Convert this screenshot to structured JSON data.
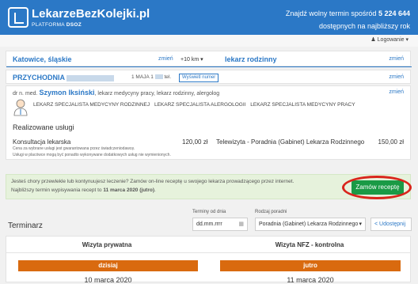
{
  "header": {
    "logo_title": "LekarzeBezKolejki.pl",
    "logo_sub_prefix": "PLATFORMA ",
    "logo_sub_brand": "DSOZ",
    "slogan_prefix": "Znajdź wolny termin spośród ",
    "slogan_count": "5 224 644",
    "slogan_line2": "dostępnych na najbliższy rok",
    "login_label": "Logowanie"
  },
  "search": {
    "location": "Katowice, śląskie",
    "location_change": "zmień",
    "radius": "+10 km",
    "specialty": "lekarz rodzinny",
    "specialty_change": "zmień"
  },
  "clinic": {
    "name": "PRZYCHODNIA",
    "address": "1 MAJA 1",
    "phone_label": "tel.",
    "phone_button": "Wyświetl numer",
    "change": "zmień"
  },
  "doctor": {
    "title": "dr n. med.",
    "name": "Szymon Iksiński",
    "desc": "lekarz medycyny pracy, lekarz rodzinny, alergolog",
    "change": "zmień",
    "specialties": [
      "LEKARZ SPECJALISTA MEDYCYNY RODZINNEJ",
      "LEKARZ SPECJALISTA ALERGOLOGII",
      "LEKARZ SPECJALISTA MEDYCYNY PRACY"
    ]
  },
  "services": {
    "heading": "Realizowane usługi",
    "items": [
      {
        "name": "Konsultacja lekarska",
        "price": "120,00 zł"
      },
      {
        "name": "Telewizyta - Poradnia (Gabinet) Lekarza Rodzinnego",
        "price": "150,00 zł"
      }
    ],
    "note1": "Cena za wybrane usługi jest gwarantowana przez świadczeniodawcę.",
    "note2": "Usługi w placówce mogą być ponadto wykonywane dodatkowych usług nie wymienionych."
  },
  "prescription": {
    "line1": "Jesteś chory przewlekle lub kontynuujesz leczenie? Zamów on-line receptę u swojego lekarza prowadzącego przez internet.",
    "line2_prefix": "Najbliższy termin wypisywania recept to ",
    "line2_date": "11 marca 2020 (jutro)",
    "line2_suffix": ".",
    "button": "Zamów receptę"
  },
  "schedule": {
    "title": "Terminarz",
    "date_label": "Terminy od dnia",
    "date_placeholder": "dd.mm.rrrr",
    "clinic_label": "Rodzaj poradni",
    "clinic_value": "Poradnia (Gabinet) Lekarza Rodzinnego",
    "share": "Udostępnij",
    "col_private": "Wizyta prywatna",
    "col_nfz": "Wizyta NFZ - kontrolna",
    "day_private": "dzisiaj",
    "day_nfz": "jutro",
    "date_private": "10 marca 2020",
    "date_nfz": "11 marca 2020"
  },
  "colors": {
    "brand": "#2b78c6",
    "order_button": "#1a9a45",
    "highlight_ring": "#d9251b",
    "day_header": "#d96a0f",
    "notice_bg": "#e6f2dc"
  }
}
